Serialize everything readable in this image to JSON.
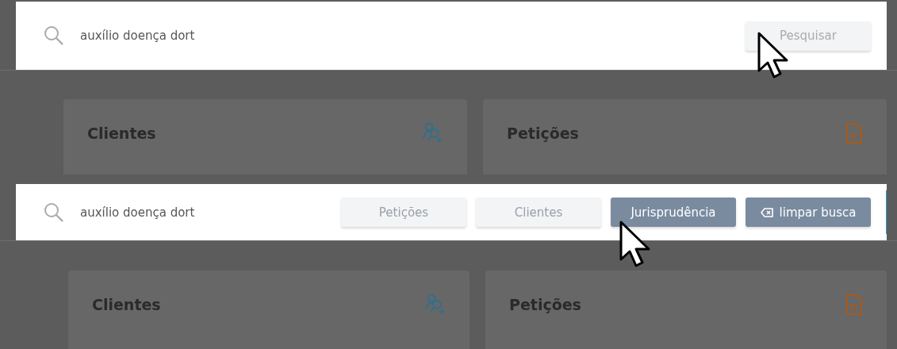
{
  "panels": [
    {
      "search": {
        "value": "auxílio doença dort"
      },
      "actions": [
        {
          "kind": "search",
          "label": "Pesquisar",
          "selected": false,
          "hovered": true
        }
      ],
      "cards": [
        {
          "title": "Clientes",
          "kind": "clients"
        },
        {
          "title": "Petições",
          "kind": "document"
        }
      ]
    },
    {
      "search": {
        "value": "auxílio doença dort"
      },
      "actions": [
        {
          "kind": "filter",
          "label": "Petições",
          "selected": false,
          "hovered": false
        },
        {
          "kind": "filter",
          "label": "Clientes",
          "selected": false,
          "hovered": false
        },
        {
          "kind": "filter",
          "label": "Jurisprudência",
          "selected": true,
          "hovered": true
        },
        {
          "kind": "clear",
          "label": "limpar busca",
          "selected": true,
          "hovered": false
        }
      ],
      "cards": [
        {
          "title": "Clientes",
          "kind": "clients"
        },
        {
          "title": "Petições",
          "kind": "document"
        }
      ]
    }
  ]
}
